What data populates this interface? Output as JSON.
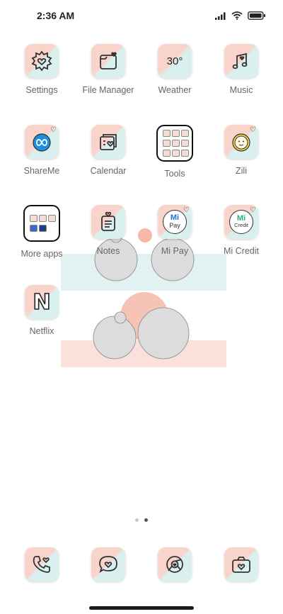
{
  "status": {
    "time": "2:36 AM"
  },
  "apps": [
    {
      "label": "Settings",
      "icon": "gear-icon"
    },
    {
      "label": "File Manager",
      "icon": "folder-icon"
    },
    {
      "label": "Weather",
      "icon": "weather-icon",
      "text": "30°"
    },
    {
      "label": "Music",
      "icon": "music-note-icon"
    },
    {
      "label": "ShareMe",
      "icon": "infinity-icon"
    },
    {
      "label": "Calendar",
      "icon": "calendar-icon"
    },
    {
      "label": "Tools",
      "icon": "tools-folder-icon"
    },
    {
      "label": "Zili",
      "icon": "zili-face-icon"
    },
    {
      "label": "More apps",
      "icon": "more-apps-folder-icon"
    },
    {
      "label": "Notes",
      "icon": "notes-icon"
    },
    {
      "label": "Mi Pay",
      "icon": "mi-pay-icon",
      "text_line1": "Mi",
      "text_line2": "Pay"
    },
    {
      "label": "Mi Credit",
      "icon": "mi-credit-icon",
      "text_line1": "Mi",
      "text_line2": "Credit"
    },
    {
      "label": "Netflix",
      "icon": "netflix-icon",
      "text": "N"
    }
  ],
  "dock": [
    {
      "icon": "phone-icon"
    },
    {
      "icon": "messages-icon"
    },
    {
      "icon": "browser-icon"
    },
    {
      "icon": "camera-icon"
    }
  ],
  "pager": {
    "pages": 2,
    "current": 2
  },
  "colors": {
    "tile_peach": "#f9d4cb",
    "tile_mint": "#d9f0ef",
    "line": "#333333"
  }
}
